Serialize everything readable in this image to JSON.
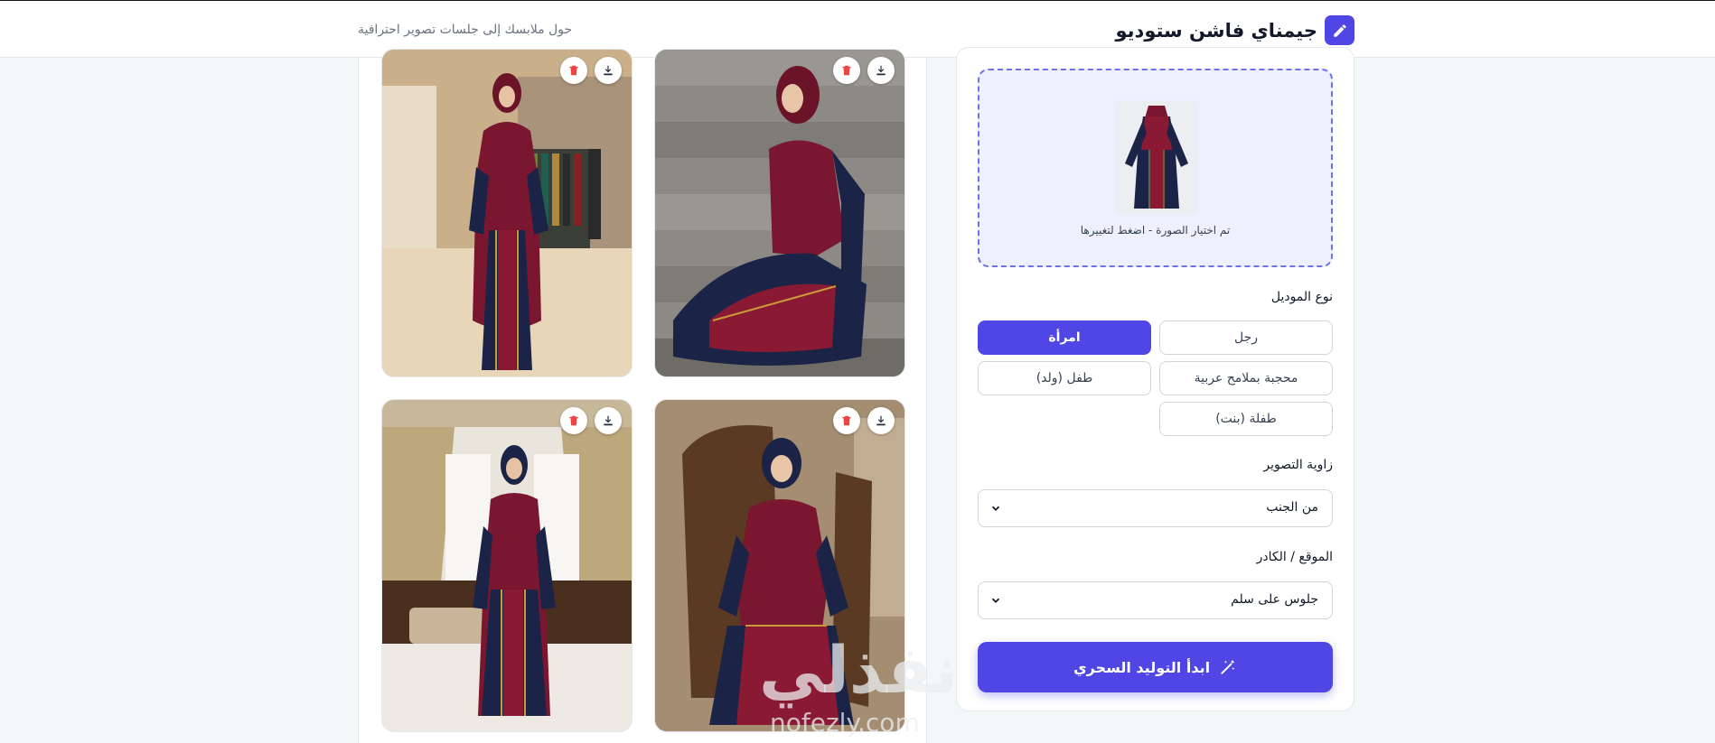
{
  "header": {
    "title": "جيمناي فاشن ستوديو",
    "subtitle": "حول ملابسك إلى جلسات تصوير احترافية",
    "logo_icon": "pencil-icon",
    "accent": "#4f46e5"
  },
  "gallery": {
    "images": [
      {
        "scene": "boutique-standing",
        "download_icon": "download-icon",
        "delete_icon": "trash-icon"
      },
      {
        "scene": "stairs-sitting",
        "download_icon": "download-icon",
        "delete_icon": "trash-icon"
      },
      {
        "scene": "hall-curtains-standing",
        "download_icon": "download-icon",
        "delete_icon": "trash-icon"
      },
      {
        "scene": "chair-sitting",
        "download_icon": "download-icon",
        "delete_icon": "trash-icon"
      }
    ]
  },
  "watermark": {
    "arabic": "نفذلي",
    "latin": "nofezly.com"
  },
  "form": {
    "upload_caption": "تم اختيار الصورة - اضغط لتغييرها",
    "model_type_label": "نوع الموديل",
    "model_types": [
      "رجل",
      "امرأة",
      "محجبة بملامح عربية",
      "طفل (ولد)",
      "طفلة (بنت)"
    ],
    "model_type_selected": "امرأة",
    "angle_label": "زاوية التصوير",
    "angle_value": "من الجنب",
    "location_label": "الموقع / الكادر",
    "location_value": "جلوس على سلم",
    "submit_label": "ابدأ التوليد السحري",
    "submit_icon": "magic-wand-icon"
  }
}
